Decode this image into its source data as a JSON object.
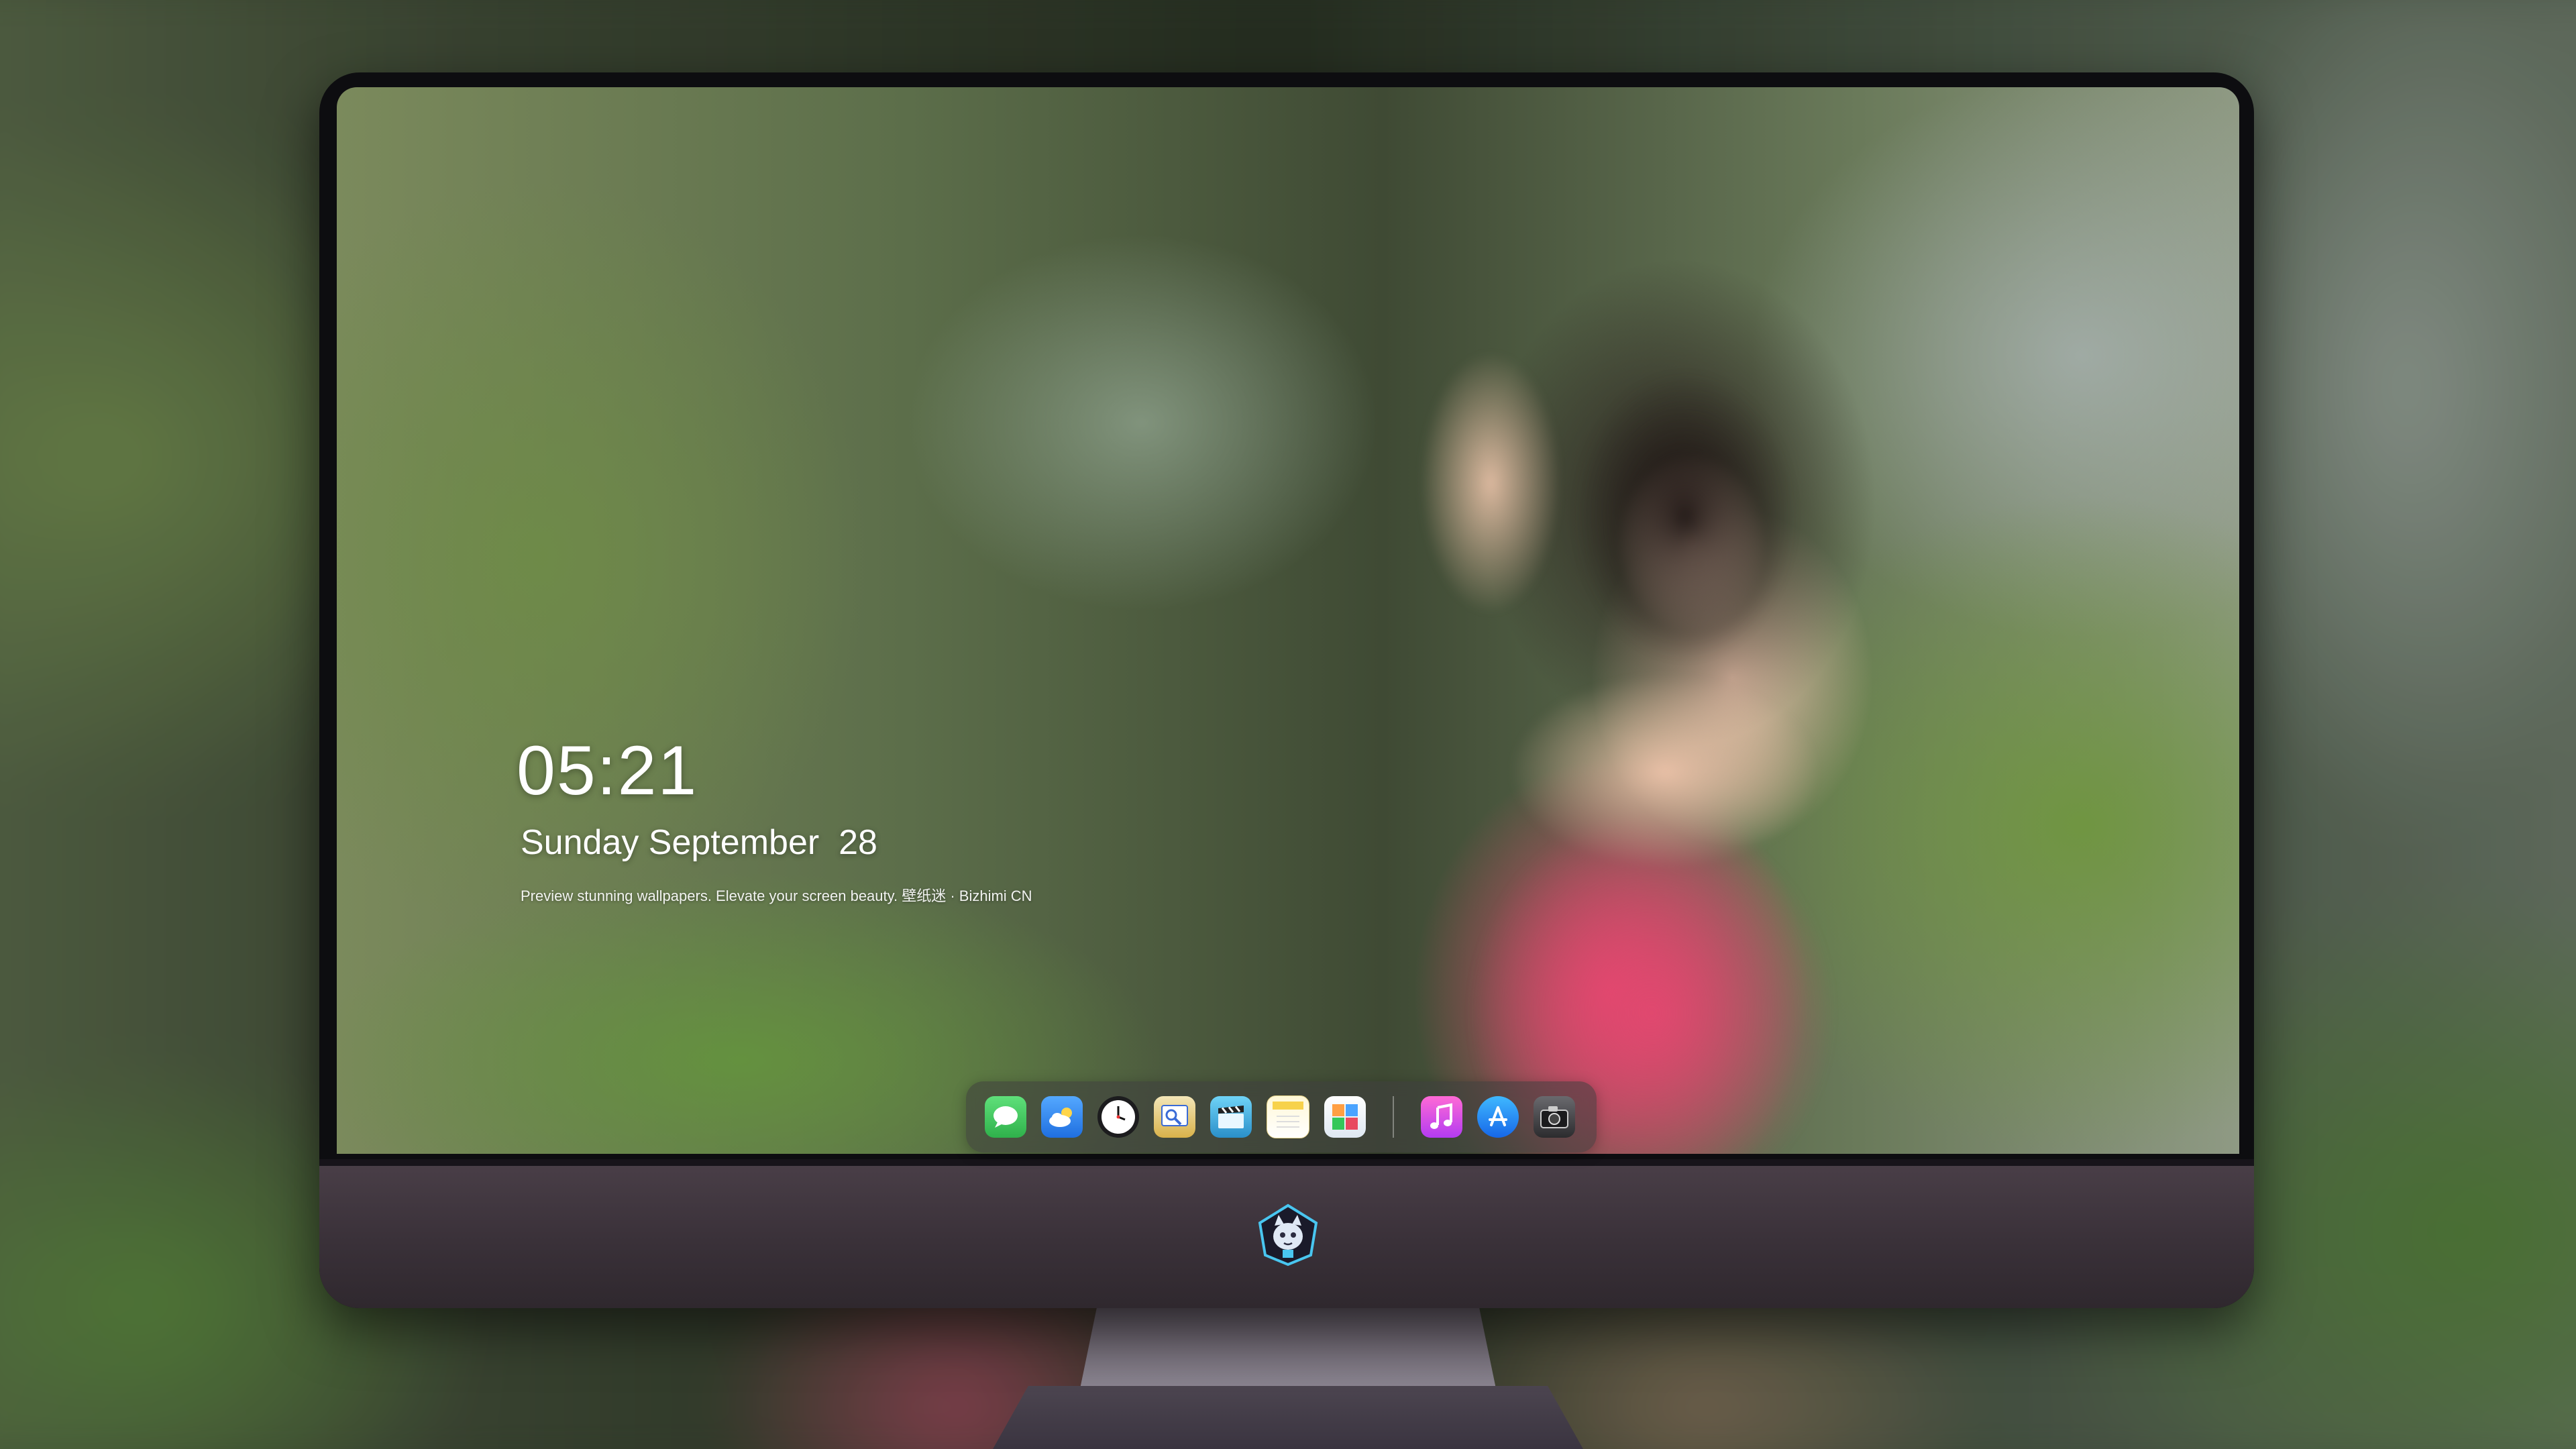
{
  "lockscreen": {
    "time": "05:21",
    "date": "Sunday September  28",
    "tagline": "Preview stunning wallpapers. Elevate your screen beauty. 壁纸迷 · Bizhimi CN"
  },
  "dock": {
    "apps": [
      {
        "icon": "messages-icon",
        "color": "#34c759"
      },
      {
        "icon": "weather-icon",
        "color": "#2f8cf0"
      },
      {
        "icon": "clock-icon",
        "color": "#1c1c1e"
      },
      {
        "icon": "preview-icon",
        "color": "#d9b24a"
      },
      {
        "icon": "clapperboard-icon",
        "color": "#3aa7d9"
      },
      {
        "icon": "notes-icon",
        "color": "#f7d24b"
      },
      {
        "icon": "photo-browser-icon",
        "color": "#4aa3ff"
      },
      {
        "icon": "music-icon",
        "color": "#e04ad0"
      },
      {
        "icon": "app-store-icon",
        "color": "#1f8ef1"
      },
      {
        "icon": "camera-icon",
        "color": "#2c2c2e"
      }
    ]
  },
  "colors": {
    "monitor_bezel": "#0d0d10",
    "monitor_chin": "#3a3139",
    "text": "#ffffff"
  }
}
